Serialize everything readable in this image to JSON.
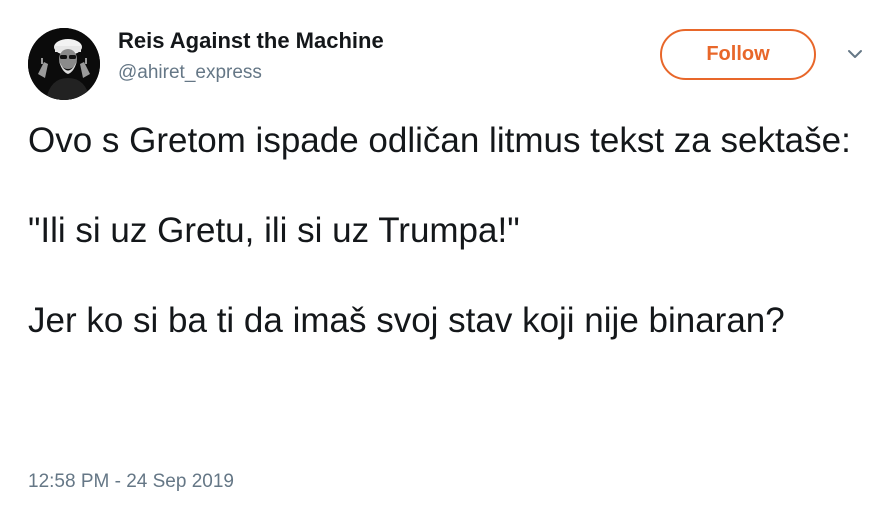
{
  "author": {
    "display_name": "Reis Against the Machine",
    "handle": "@ahiret_express",
    "avatar_icon": "avatar-portrait"
  },
  "actions": {
    "follow_label": "Follow",
    "menu_icon": "chevron-down-icon"
  },
  "tweet": {
    "paragraphs": [
      "Ovo s Gretom ispade odličan litmus tekst za sektaše:",
      "\"Ili si uz Gretu, ili si uz Trumpa!\"",
      "Jer ko si ba ti da imaš svoj stav koji nije binaran?"
    ],
    "timestamp": "12:58 PM - 24 Sep 2019"
  },
  "colors": {
    "accent": "#e8672a",
    "text": "#14171a",
    "muted": "#657786",
    "background": "#ffffff"
  }
}
